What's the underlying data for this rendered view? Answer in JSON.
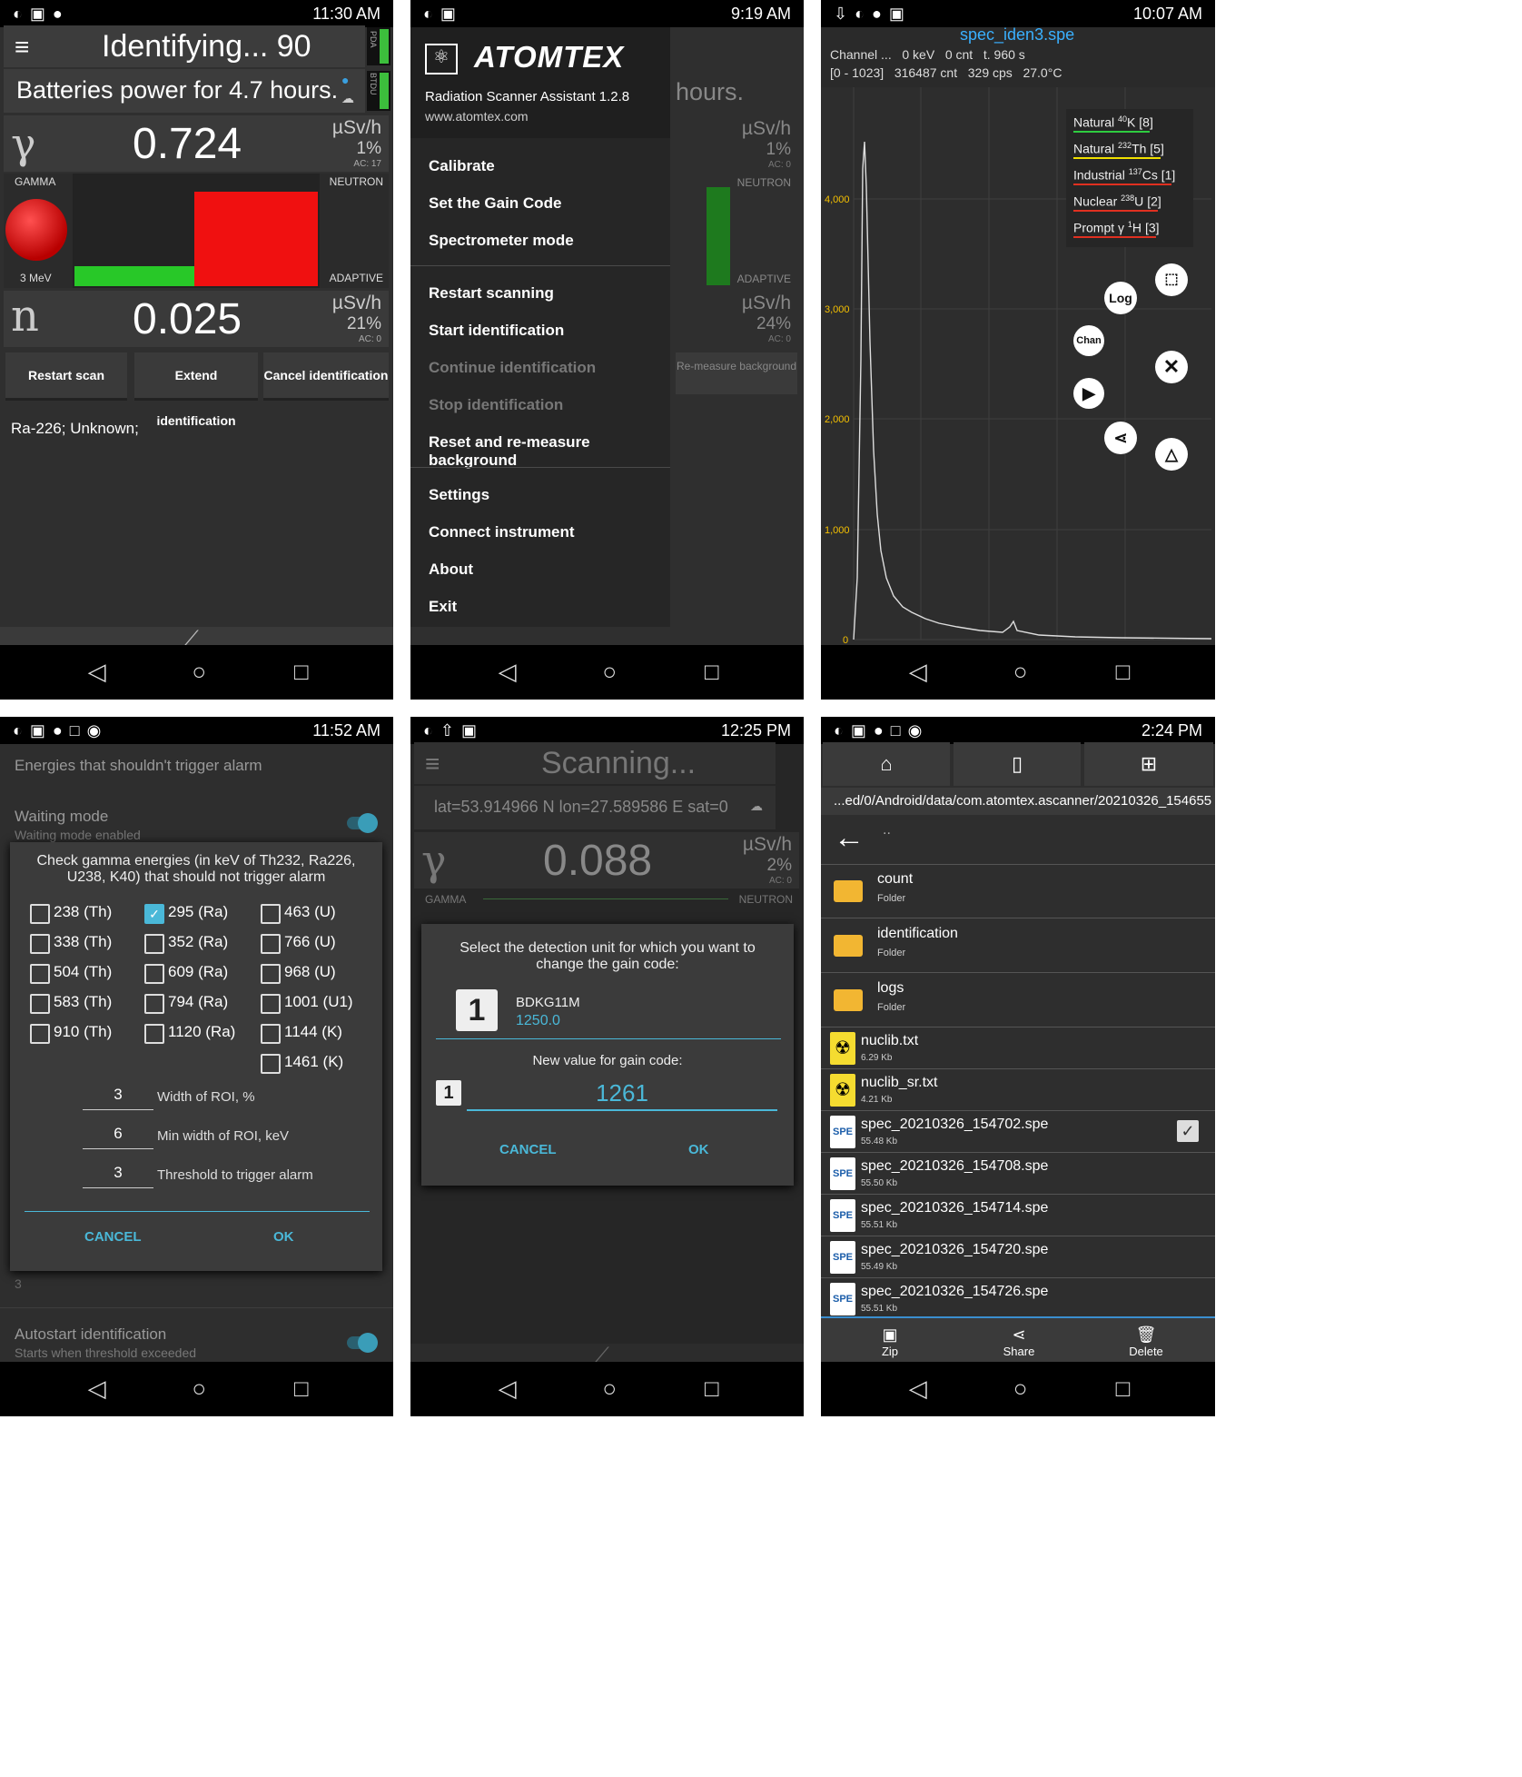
{
  "status_bar": {
    "time_1": "11:30 AM",
    "time_2": "9:19 AM",
    "time_3": "10:07 AM",
    "time_4": "11:52 AM",
    "time_5": "12:25 PM",
    "time_6": "2:24 PM"
  },
  "s1": {
    "title": "Identifying... 90",
    "subtitle": "Batteries power for 4.7 hours.",
    "gamma_value": "0.724",
    "gamma_unit": "µSv/h",
    "gamma_pct": "1%",
    "gamma_ac": "AC: 17",
    "label_gamma": "GAMMA",
    "label_neutron": "NEUTRON",
    "label_3mev": "3 MeV",
    "label_adaptive": "ADAPTIVE",
    "neutron_value": "0.025",
    "neutron_unit": "µSv/h",
    "neutron_pct": "21%",
    "neutron_ac": "AC: 0",
    "btn_restart": "Restart scan",
    "btn_extend": "Extend identification",
    "btn_cancel": "Cancel identification",
    "result": "Ra-226; Unknown;",
    "pda": "PDA",
    "btdu": "BTDU"
  },
  "s2": {
    "brand": "ATOMTEX",
    "app_name": "Radiation Scanner Assistant 1.2.8",
    "url": "www.atomtex.com",
    "items": [
      "Calibrate",
      "Set the Gain Code",
      "Spectrometer mode",
      "Restart scanning",
      "Start identification",
      "Continue identification",
      "Stop identification",
      "Reset and re-measure background",
      "Settings",
      "Connect instrument",
      "About",
      "Exit"
    ],
    "bg_hours": "hours.",
    "bg_unit": "µSv/h",
    "bg_pct1": "1%",
    "bg_ac1": "AC: 0",
    "bg_neutron": "NEUTRON",
    "bg_adaptive": "ADAPTIVE",
    "bg_pct2": "24%",
    "bg_ac2": "AC: 0",
    "bg_remeasure": "Re-measure background"
  },
  "s3": {
    "file": "spec_iden3.spe",
    "line1": "Channel ...   0 keV   0 cnt   t. 960 s",
    "line2": "[0 - 1023]   316487 cnt   329 cps   27.0°C",
    "legend": [
      {
        "name": "Natural",
        "sup": "40",
        "el": "K",
        "count": "[8]",
        "color": "#2ecc40"
      },
      {
        "name": "Natural",
        "sup": "232",
        "el": "Th",
        "count": "[5]",
        "color": "#f0e000"
      },
      {
        "name": "Industrial",
        "sup": "137",
        "el": "Cs",
        "count": "[1]",
        "color": "#e03020"
      },
      {
        "name": "Nuclear",
        "sup": "238",
        "el": "U",
        "count": "[2]",
        "color": "#e03020"
      },
      {
        "name": "Prompt γ",
        "sup": "1",
        "el": "H",
        "count": "[3]",
        "color": "#e03020"
      }
    ],
    "btn_log": "Log",
    "btn_chan": "Chan"
  },
  "s4": {
    "heading": "Energies that shouldn't trigger alarm",
    "waiting_title": "Waiting mode",
    "waiting_sub": "Waiting mode enabled",
    "dialog_title": "Check gamma energies (in keV of Th232, Ra226, U238, K40) that should not trigger alarm",
    "col1": [
      "238 (Th)",
      "338 (Th)",
      "504 (Th)",
      "583 (Th)",
      "910 (Th)"
    ],
    "col2": [
      "295 (Ra)",
      "352 (Ra)",
      "609 (Ra)",
      "794 (Ra)",
      "1120 (Ra)"
    ],
    "col3": [
      "463 (U)",
      "766 (U)",
      "968 (U)",
      "1001 (U1)",
      "1144 (K)",
      "1461 (K)"
    ],
    "field1_value": "3",
    "field1_label": "Width of ROI, %",
    "field2_value": "6",
    "field2_label": "Min width of ROI, keV",
    "field3_value": "3",
    "field3_label": "Threshold to trigger alarm",
    "cancel": "CANCEL",
    "ok": "OK",
    "below_value": "3",
    "autostart_title": "Autostart identification",
    "autostart_sub": "Starts when threshold exceeded"
  },
  "s5": {
    "title": "Scanning...",
    "coords": "lat=53.914966 N lon=27.589586 E sat=0",
    "value": "0.088",
    "unit": "µSv/h",
    "pct": "2%",
    "ac": "AC: 0",
    "gamma": "GAMMA",
    "neutron": "NEUTRON",
    "dialog_text": "Select the detection unit for which you want to change the gain code:",
    "unit_num": "1",
    "unit_name": "BDKG11M",
    "unit_value": "1250.0",
    "new_value_label": "New value for gain code:",
    "new_value": "1261",
    "cancel": "CANCEL",
    "ok": "OK"
  },
  "s6": {
    "path": "...ed/0/Android/data/com.atomtex.ascanner/20210326_154655",
    "parent": "..",
    "folders": [
      {
        "name": "count",
        "sub": "Folder"
      },
      {
        "name": "identification",
        "sub": "Folder"
      },
      {
        "name": "logs",
        "sub": "Folder"
      }
    ],
    "txt_files": [
      {
        "name": "nuclib.txt",
        "size": "6.29 Kb"
      },
      {
        "name": "nuclib_sr.txt",
        "size": "4.21 Kb"
      }
    ],
    "spe_files": [
      {
        "name": "spec_20210326_154702.spe",
        "size": "55.48 Kb"
      },
      {
        "name": "spec_20210326_154708.spe",
        "size": "55.50 Kb"
      },
      {
        "name": "spec_20210326_154714.spe",
        "size": "55.51 Kb"
      },
      {
        "name": "spec_20210326_154720.spe",
        "size": "55.49 Kb"
      },
      {
        "name": "spec_20210326_154726.spe",
        "size": "55.51 Kb"
      }
    ],
    "zip": "Zip",
    "share": "Share",
    "delete": "Delete"
  }
}
